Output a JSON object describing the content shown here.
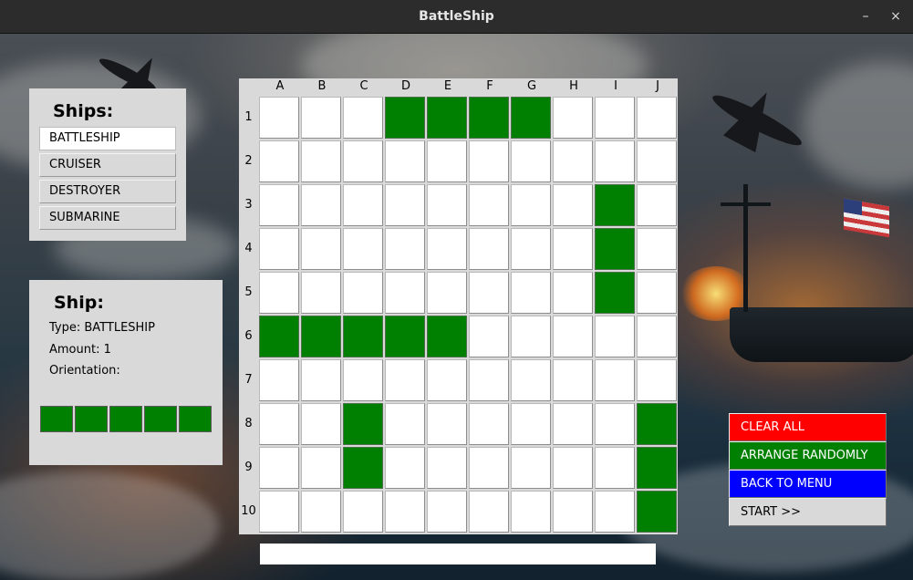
{
  "window": {
    "title": "BattleShip",
    "minimize_glyph": "–",
    "close_glyph": "×"
  },
  "ships_panel": {
    "title": "Ships:",
    "items": [
      {
        "label": "BATTLESHIP",
        "selected": true
      },
      {
        "label": "CRUISER",
        "selected": false
      },
      {
        "label": "DESTROYER",
        "selected": false
      },
      {
        "label": "SUBMARINE",
        "selected": false
      }
    ]
  },
  "ship_info": {
    "title": "Ship:",
    "type_line": "Type: BATTLESHIP",
    "amount_line": "Amount: 1",
    "orientation_line": "Orientation:",
    "preview_length": 5,
    "preview_color": "#008000"
  },
  "board": {
    "columns": [
      "A",
      "B",
      "C",
      "D",
      "E",
      "F",
      "G",
      "H",
      "I",
      "J"
    ],
    "rows": [
      "1",
      "2",
      "3",
      "4",
      "5",
      "6",
      "7",
      "8",
      "9",
      "10"
    ],
    "ship_color": "#008000",
    "empty_color": "#ffffff",
    "occupied_cells": [
      "D1",
      "E1",
      "F1",
      "G1",
      "I3",
      "I4",
      "I5",
      "A6",
      "B6",
      "C6",
      "D6",
      "E6",
      "C8",
      "C9",
      "J8",
      "J9",
      "J10"
    ]
  },
  "status_text": "",
  "actions": [
    {
      "label": "CLEAR ALL",
      "bg": "#ff0000",
      "fg": "#ffffff"
    },
    {
      "label": "ARRANGE RANDOMLY",
      "bg": "#008000",
      "fg": "#ffffff"
    },
    {
      "label": "BACK TO MENU",
      "bg": "#0000ff",
      "fg": "#ffffff"
    },
    {
      "label": "START >>",
      "bg": "#d9d9d9",
      "fg": "#000000"
    }
  ]
}
